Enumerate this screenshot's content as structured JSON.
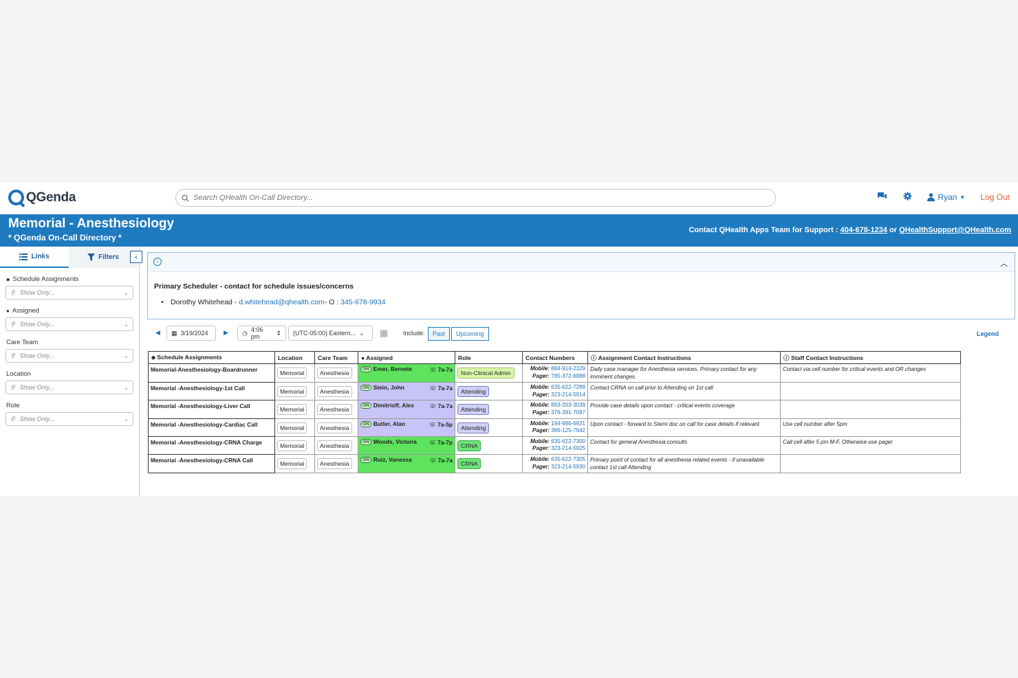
{
  "app": {
    "logo_text": "QGenda",
    "search_placeholder": "Search QHealth On-Call Directory...",
    "user_name": "Ryan",
    "logout_label": "Log Out"
  },
  "header": {
    "title": "Memorial - Anesthesiology",
    "subtitle": "* QGenda On-Call Directory *",
    "contact_prefix": "Contact QHealth Apps Team for Support :",
    "contact_phone": "404-678-1234",
    "contact_or": "or",
    "contact_email": "QHealthSupport@QHealth.com",
    "accent_color": "#1f7bbf"
  },
  "sidebar": {
    "tabs": [
      {
        "label": "Links",
        "icon": "list-icon"
      },
      {
        "label": "Filters",
        "icon": "funnel-icon"
      }
    ],
    "filters": [
      {
        "label": "Schedule Assignments",
        "placeholder": "Show Only..."
      },
      {
        "label": "Assigned",
        "placeholder": "Show Only..."
      },
      {
        "label": "Care Team",
        "placeholder": "Show Only..."
      },
      {
        "label": "Location",
        "placeholder": "Show Only..."
      },
      {
        "label": "Role",
        "placeholder": "Show Only..."
      }
    ]
  },
  "info": {
    "title": "Primary Scheduler - contact for schedule issues/concerns",
    "person": "Dorothy Whitehead - ",
    "email": "d.whitehead@qhealth.com",
    "office_label": "- O : ",
    "phone": "345-678-9934"
  },
  "controls": {
    "date": "3/19/2024",
    "time": "4:06 pm",
    "timezone": "(UTC-05:00) Eastern...",
    "include_label": "Include:",
    "past_label": "Past",
    "upcoming_label": "Upcoming",
    "legend_label": "Legend"
  },
  "table": {
    "headers": {
      "schedule": "Schedule Assignments",
      "location": "Location",
      "care_team": "Care Team",
      "assigned": "Assigned",
      "role": "Role",
      "contact": "Contact Numbers",
      "assignment_instr": "Assignment Contact Instructions",
      "staff_instr": "Staff Contact Instructions"
    },
    "on_badge": "ON",
    "mobile_label": "Mobile:",
    "pager_label": "Pager:",
    "rows": [
      {
        "schedule": "Memorial-Anesthesiology-Boardrunner",
        "location": "Memorial",
        "care_team": "Anesthesia",
        "assigned": "Emer, Bernete",
        "shift": "7a-7a",
        "role": "Non-Clinical Admin",
        "mobile": "884-914-2329",
        "pager": "785-372-6988",
        "assignment_instr": "Daily case manager for Anesthesia services. Primary contact for any imminent changes.",
        "staff_instr": "Contact via cell number for critical events and OR changes"
      },
      {
        "schedule": "Memorial -Anesthesiology-1st Call",
        "location": "Memorial",
        "care_team": "Anesthesia",
        "assigned": "Stein, John",
        "shift": "7a-7a",
        "role": "Attending",
        "mobile": "635-622-7289",
        "pager": "323-214-5914",
        "assignment_instr": "Contact CRNA on call prior to Attending on 1st call",
        "staff_instr": ""
      },
      {
        "schedule": "Memorial -Anesthesiology-Liver Call",
        "location": "Memorial",
        "care_team": "Anesthesia",
        "assigned": "Dimitrioff, Alex",
        "shift": "7a-7a",
        "role": "Attending",
        "mobile": "893-203-3039",
        "pager": "376-391-7097",
        "assignment_instr": "Provide case details upon contact - critical events coverage",
        "staff_instr": ""
      },
      {
        "schedule": "Memorial -Anesthesiology-Cardiac Call",
        "location": "Memorial",
        "care_team": "Anesthesia",
        "assigned": "Butler, Alan",
        "shift": "7a-5p",
        "role": "Attending",
        "mobile": "194-986-6921",
        "pager": "386-125-7642",
        "assignment_instr": "Upon contact - forward to Stemi doc on call for case details if relevant",
        "staff_instr": "Use cell number after 5pm"
      },
      {
        "schedule": "Memorial -Anesthesiology-CRNA Charge",
        "location": "Memorial",
        "care_team": "Anesthesia",
        "assigned": "Woods, Victoria",
        "shift": "7a-7p",
        "role": "CRNA",
        "mobile": "635-622-7300",
        "pager": "323-214-5925",
        "assignment_instr": "Contact for general Anesthesia consults",
        "staff_instr": "Call cell after 5 pm M-F. Otherwise use pager"
      },
      {
        "schedule": "Memorial -Anesthesiology-CRNA Call",
        "location": "Memorial",
        "care_team": "Anesthesia",
        "assigned": "Ruiz, Vanessa",
        "shift": "7a-7a",
        "role": "CRNA",
        "mobile": "635-622-7305",
        "pager": "323-214-5930",
        "assignment_instr": "Primary point of contact for all anesthesia related events - if unavailable contact 1st call Attending",
        "staff_instr": ""
      }
    ],
    "colors": {
      "green": "#5ee35e",
      "lavender": "#c9c4f7",
      "role_admin": "#d8f7a8",
      "role_attending": "#cfd0f5",
      "role_crna": "#6fe27a"
    }
  }
}
